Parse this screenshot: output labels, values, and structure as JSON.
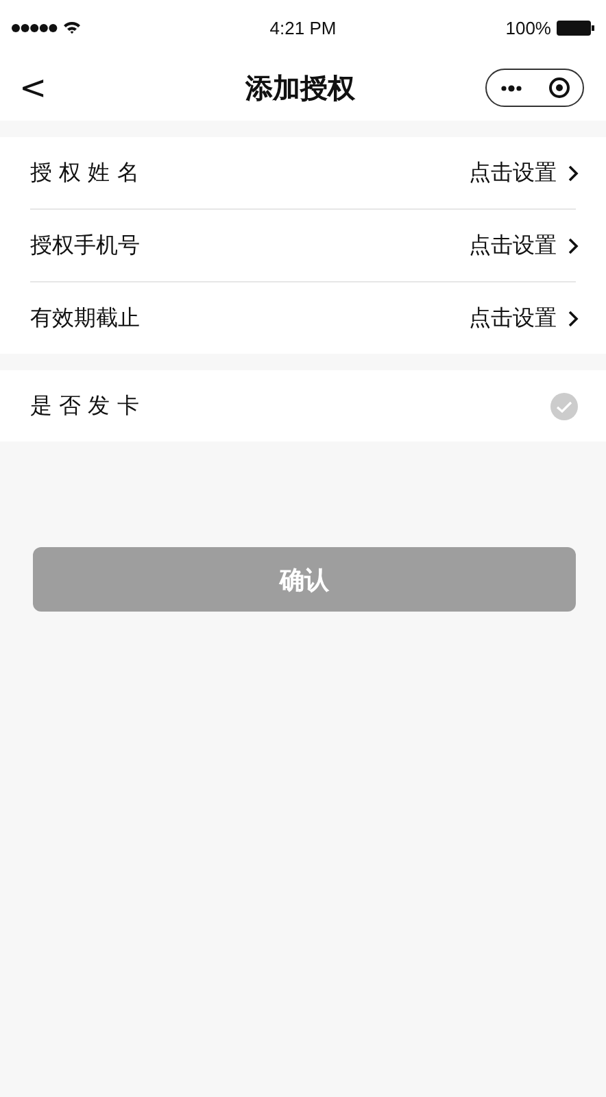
{
  "status_bar": {
    "time": "4:21 PM",
    "battery": "100%"
  },
  "nav": {
    "title": "添加授权",
    "back": "<"
  },
  "settings": [
    {
      "label": "授 权 姓 名",
      "value": "点击设置"
    },
    {
      "label": "授权手机号",
      "value": "点击设置"
    },
    {
      "label": "有效期截止",
      "value": "点击设置"
    }
  ],
  "card_option": {
    "label": "是 否 发 卡",
    "checked": false
  },
  "confirm_button": {
    "label": "确认",
    "disabled": true
  }
}
